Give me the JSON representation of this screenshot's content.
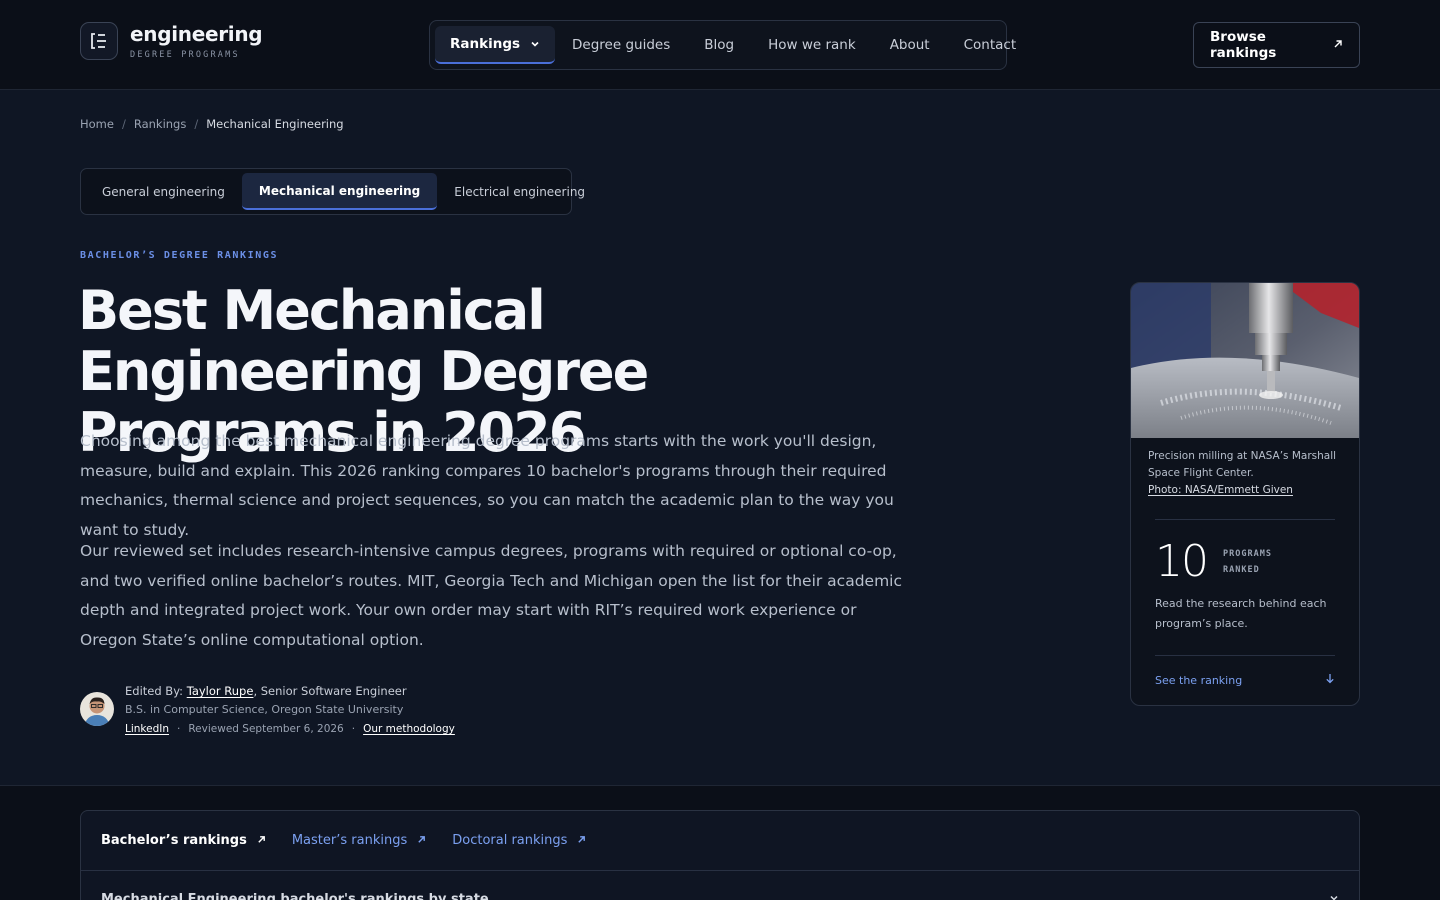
{
  "header": {
    "logo": {
      "name": "engineering",
      "subtitle": "DEGREE PROGRAMS",
      "mark": "E"
    },
    "nav": [
      {
        "label": "Rankings",
        "active": true,
        "icon": "chevron-down-icon"
      },
      {
        "label": "Degree guides"
      },
      {
        "label": "Blog"
      },
      {
        "label": "How we rank"
      },
      {
        "label": "About"
      },
      {
        "label": "Contact"
      }
    ],
    "cta": {
      "label": "Browse rankings",
      "icon": "arrow-up-right-icon"
    }
  },
  "breadcrumb": {
    "home": "Home",
    "rankings": "Rankings",
    "current": "Mechanical Engineering",
    "separator": "/"
  },
  "tabs": [
    {
      "label": "General engineering"
    },
    {
      "label": "Mechanical engineering",
      "active": true
    },
    {
      "label": "Electrical engineering"
    }
  ],
  "hero": {
    "eyebrow": "BACHELOR’S DEGREE RANKINGS",
    "title": "Best Mechanical Engineering Degree Programs in 2026",
    "paragraph1": "Choosing among the best mechanical engineering degree programs starts with the work you'll design, measure, build and explain. This 2026 ranking compares 10 bachelor's programs through their required mechanics, thermal science and project sequences, so you can match the academic plan to the way you want to study.",
    "paragraph2": "Our reviewed set includes research-intensive campus degrees, programs with required or optional co-op, and two verified online bachelor’s routes. MIT, Georgia Tech and Michigan open the list for their academic depth and integrated project work. Your own order may start with RIT’s required work experience or Oregon State’s online computational option."
  },
  "author": {
    "edited_by_label": "Edited By:",
    "name": "Taylor Rupe",
    "role": ", Senior Software Engineer",
    "credential": "B.S. in Computer Science, Oregon State University",
    "linkedin": "LinkedIn",
    "dot": "·",
    "reviewed": "Reviewed September 6, 2026",
    "methodology": "Our methodology"
  },
  "card": {
    "caption": "Precision milling at NASA’s Marshall Space Flight Center.",
    "credit": "Photo: NASA/Emmett Given",
    "stat_number": "10",
    "stat_label_1": "PROGRAMS",
    "stat_label_2": "RANKED",
    "stat_text": "Read the research behind each program’s place.",
    "link": "See the ranking",
    "link_icon": "arrow-down-icon"
  },
  "bottom": {
    "tabs": [
      {
        "label": "Bachelor’s rankings",
        "active": true
      },
      {
        "label": "Master’s rankings"
      },
      {
        "label": "Doctoral rankings"
      }
    ],
    "row_label": "Mechanical Engineering bachelor's rankings by state"
  },
  "colors": {
    "accent": "#4a6fd9",
    "link": "#7ba0f0",
    "background": "#0f1624",
    "header": "#0b0f18"
  }
}
